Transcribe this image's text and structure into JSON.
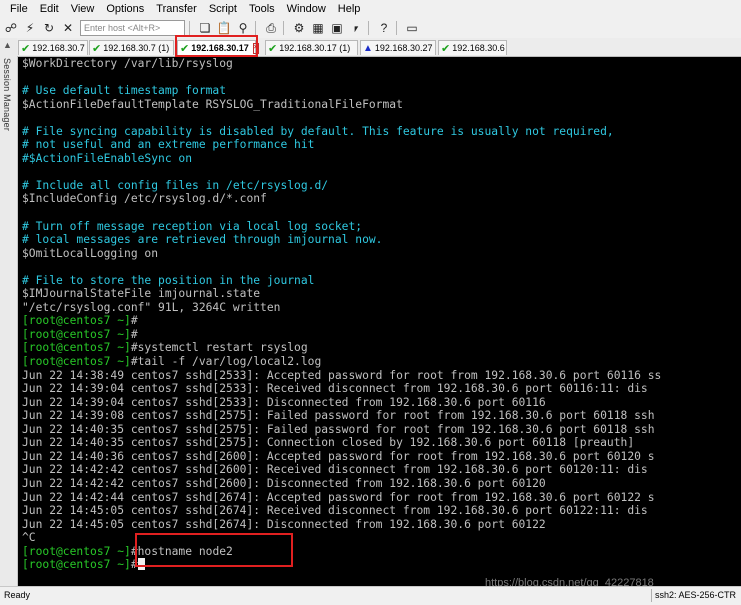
{
  "menu": [
    "File",
    "Edit",
    "View",
    "Options",
    "Transfer",
    "Script",
    "Tools",
    "Window",
    "Help"
  ],
  "toolbar": {
    "host_placeholder": "Enter host <Alt+R>"
  },
  "session_manager": {
    "label": "Session Manager"
  },
  "tabs": [
    {
      "label": "192.168.30.7",
      "status": "ok",
      "active": false
    },
    {
      "label": "192.168.30.7 (1)",
      "status": "ok",
      "active": false
    },
    {
      "label": "192.168.30.17",
      "status": "ok",
      "active": true
    },
    {
      "label": "192.168.30.17 (1)",
      "status": "ok",
      "active": false
    },
    {
      "label": "192.168.30.27",
      "status": "warning",
      "active": false
    },
    {
      "label": "192.168.30.6",
      "status": "ok",
      "active": false
    }
  ],
  "terminal": {
    "lines": [
      {
        "text": "$WorkDirectory /var/lib/rsyslog",
        "color": "default"
      },
      {
        "text": "",
        "color": "default"
      },
      {
        "text": "# Use default timestamp format",
        "color": "cyan"
      },
      {
        "text": "$ActionFileDefaultTemplate RSYSLOG_TraditionalFileFormat",
        "color": "default"
      },
      {
        "text": "",
        "color": "default"
      },
      {
        "text": "# File syncing capability is disabled by default. This feature is usually not required,",
        "color": "cyan"
      },
      {
        "text": "# not useful and an extreme performance hit",
        "color": "cyan"
      },
      {
        "text": "#$ActionFileEnableSync on",
        "color": "cyan"
      },
      {
        "text": "",
        "color": "default"
      },
      {
        "text": "# Include all config files in /etc/rsyslog.d/",
        "color": "cyan"
      },
      {
        "text": "$IncludeConfig /etc/rsyslog.d/*.conf",
        "color": "default"
      },
      {
        "text": "",
        "color": "default"
      },
      {
        "text": "# Turn off message reception via local log socket;",
        "color": "cyan"
      },
      {
        "text": "# local messages are retrieved through imjournal now.",
        "color": "cyan"
      },
      {
        "text": "$OmitLocalLogging on",
        "color": "default"
      },
      {
        "text": "",
        "color": "default"
      },
      {
        "text": "# File to store the position in the journal",
        "color": "cyan"
      },
      {
        "text": "$IMJournalStateFile imjournal.state",
        "color": "default"
      },
      {
        "text": "\"/etc/rsyslog.conf\" 91L, 3264C written",
        "color": "default"
      },
      {
        "prompt": "[root@centos7 ~]",
        "text": "#",
        "color": "default"
      },
      {
        "prompt": "[root@centos7 ~]",
        "text": "#",
        "color": "default"
      },
      {
        "prompt": "[root@centos7 ~]",
        "text": "#systemctl restart rsyslog",
        "color": "default"
      },
      {
        "prompt": "[root@centos7 ~]",
        "text": "#tail -f /var/log/local2.log",
        "color": "default"
      },
      {
        "text": "Jun 22 14:38:49 centos7 sshd[2533]: Accepted password for root from 192.168.30.6 port 60116 ss",
        "color": "default"
      },
      {
        "text": "Jun 22 14:39:04 centos7 sshd[2533]: Received disconnect from 192.168.30.6 port 60116:11: dis",
        "color": "default"
      },
      {
        "text": "Jun 22 14:39:04 centos7 sshd[2533]: Disconnected from 192.168.30.6 port 60116",
        "color": "default"
      },
      {
        "text": "Jun 22 14:39:08 centos7 sshd[2575]: Failed password for root from 192.168.30.6 port 60118 ssh",
        "color": "default"
      },
      {
        "text": "Jun 22 14:40:35 centos7 sshd[2575]: Failed password for root from 192.168.30.6 port 60118 ssh",
        "color": "default"
      },
      {
        "text": "Jun 22 14:40:35 centos7 sshd[2575]: Connection closed by 192.168.30.6 port 60118 [preauth]",
        "color": "default"
      },
      {
        "text": "Jun 22 14:40:36 centos7 sshd[2600]: Accepted password for root from 192.168.30.6 port 60120 s",
        "color": "default"
      },
      {
        "text": "Jun 22 14:42:42 centos7 sshd[2600]: Received disconnect from 192.168.30.6 port 60120:11: dis",
        "color": "default"
      },
      {
        "text": "Jun 22 14:42:42 centos7 sshd[2600]: Disconnected from 192.168.30.6 port 60120",
        "color": "default"
      },
      {
        "text": "Jun 22 14:42:44 centos7 sshd[2674]: Accepted password for root from 192.168.30.6 port 60122 s",
        "color": "default"
      },
      {
        "text": "Jun 22 14:45:05 centos7 sshd[2674]: Received disconnect from 192.168.30.6 port 60122:11: dis",
        "color": "default"
      },
      {
        "text": "Jun 22 14:45:05 centos7 sshd[2674]: Disconnected from 192.168.30.6 port 60122",
        "color": "default"
      },
      {
        "text": "^C",
        "color": "default"
      },
      {
        "prompt": "[root@centos7 ~]",
        "text": "#hostname node2",
        "color": "default"
      },
      {
        "prompt": "[root@centos7 ~]",
        "text": "#",
        "color": "default",
        "cursor": true
      }
    ]
  },
  "status_bar": {
    "left": "Ready",
    "right": "ssh2: AES-256-CTR"
  },
  "watermark": "https://blog.csdn.net/qq_42227818",
  "colors": {
    "terminal_bg": "#000000",
    "terminal_fg": "#c0c0c0",
    "comment": "#2fc8e0",
    "prompt": "#28c828",
    "highlight": "#e02020"
  }
}
